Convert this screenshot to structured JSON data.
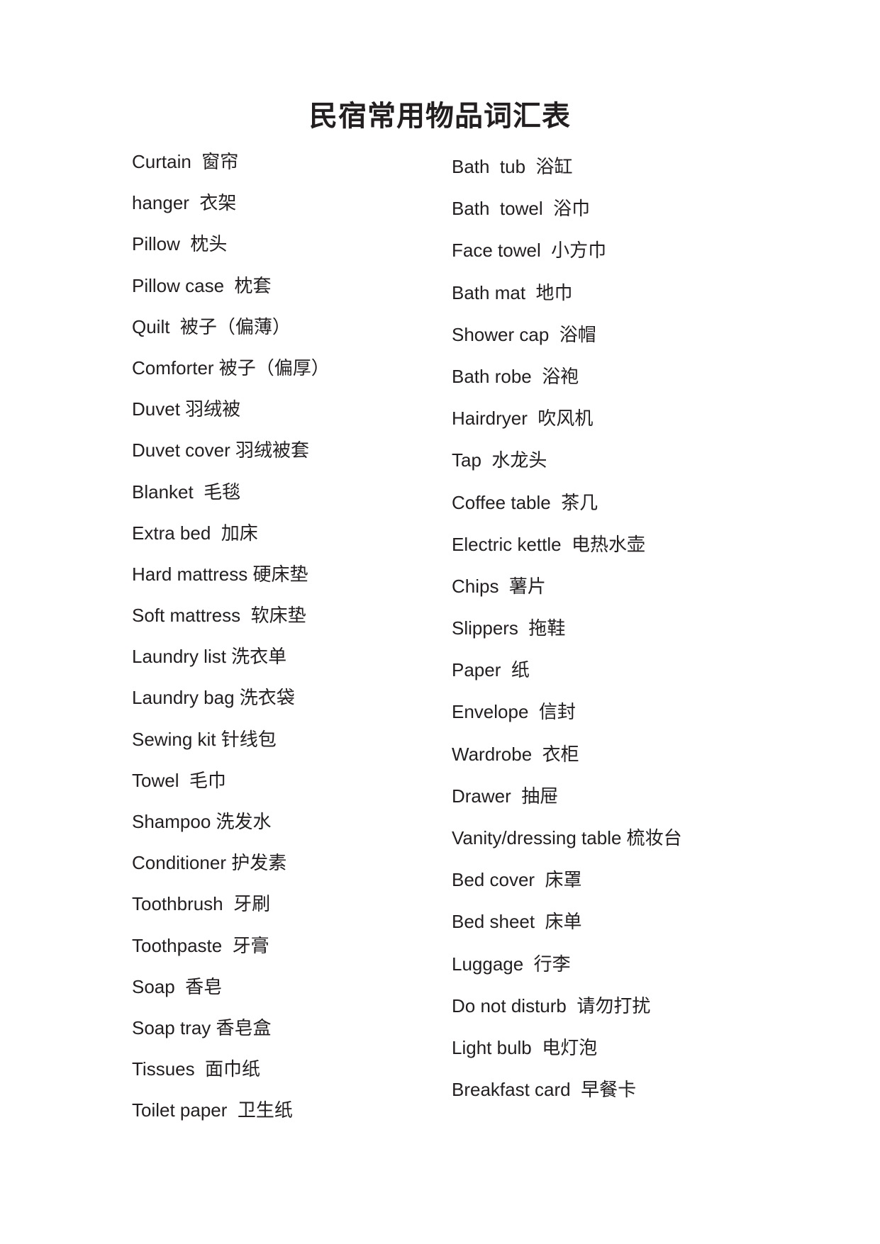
{
  "document": {
    "title": "民宿常用物品词汇表"
  },
  "columns": {
    "left": {
      "items": [
        "Curtain  窗帘",
        "hanger  衣架",
        "Pillow  枕头",
        "Pillow case  枕套",
        "Quilt  被子（偏薄）",
        "Comforter 被子（偏厚）",
        "Duvet 羽绒被",
        "Duvet cover 羽绒被套",
        "Blanket  毛毯",
        "Extra bed  加床",
        "Hard mattress 硬床垫",
        "Soft mattress  软床垫",
        "Laundry list 洗衣单",
        "Laundry bag 洗衣袋",
        "Sewing kit 针线包",
        "Towel  毛巾",
        "Shampoo 洗发水",
        "Conditioner 护发素",
        "Toothbrush  牙刷",
        "Toothpaste  牙膏",
        "Soap  香皂",
        "Soap tray 香皂盒",
        "Tissues  面巾纸",
        "Toilet paper  卫生纸"
      ]
    },
    "right": {
      "items": [
        "Bath  tub  浴缸",
        "Bath  towel  浴巾",
        "Face towel  小方巾",
        "Bath mat  地巾",
        "Shower cap  浴帽",
        "Bath robe  浴袍",
        "Hairdryer  吹风机",
        "Tap  水龙头",
        "Coffee table  茶几",
        "Electric kettle  电热水壶",
        "Chips  薯片",
        "Slippers  拖鞋",
        "Paper  纸",
        "Envelope  信封",
        "Wardrobe  衣柜",
        "Drawer  抽屉",
        "Vanity/dressing table 梳妆台",
        "Bed cover  床罩",
        "Bed sheet  床单",
        "Luggage  行李",
        "Do not disturb  请勿打扰",
        "Light bulb  电灯泡",
        "Breakfast card  早餐卡"
      ]
    }
  }
}
